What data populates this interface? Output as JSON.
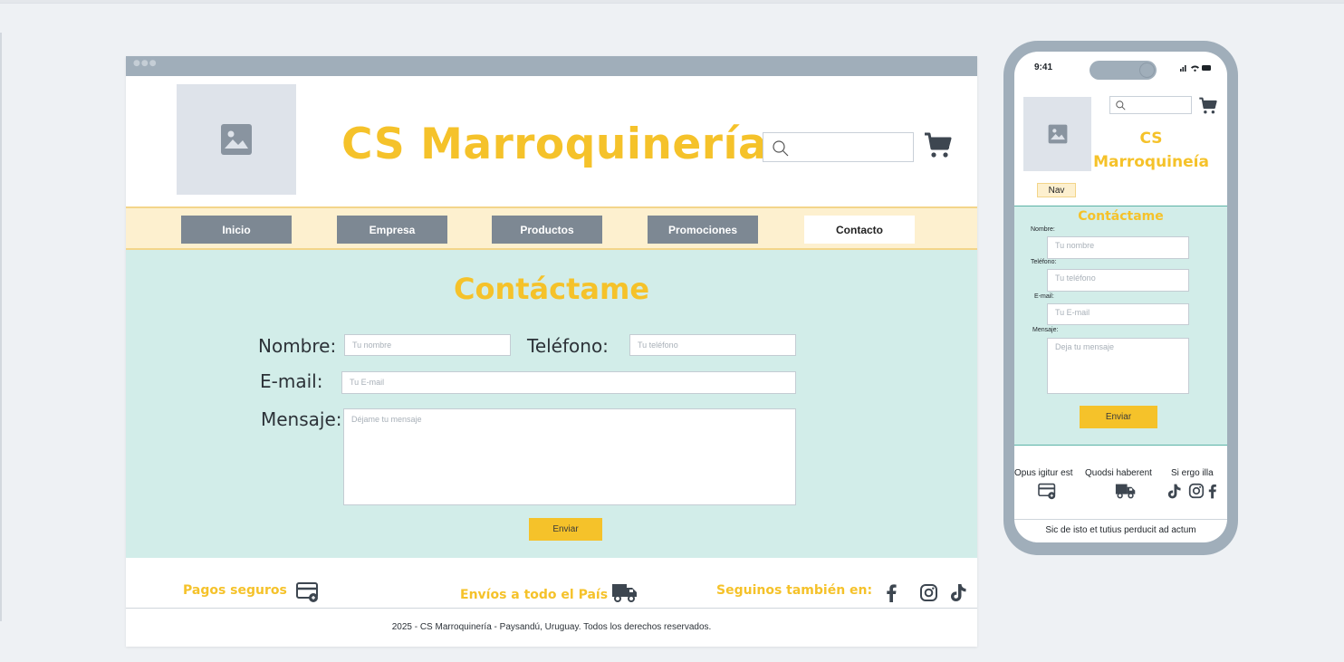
{
  "desktop": {
    "brand": "CS Marroquinería",
    "nav": [
      "Inicio",
      "Empresa",
      "Productos",
      "Promociones",
      "Contacto"
    ],
    "active_nav": "Contacto",
    "form": {
      "title": "Contáctame",
      "name_label": "Nombre:",
      "name_placeholder": "Tu nombre",
      "phone_label": "Teléfono:",
      "phone_placeholder": "Tu teléfono",
      "email_label": "E-mail:",
      "email_placeholder": "Tu E-mail",
      "message_label": "Mensaje:",
      "message_placeholder": "Déjame tu mensaje",
      "send_label": "Enviar"
    },
    "footer": {
      "payments": "Pagos seguros",
      "shipping": "Envíos a todo el País",
      "social": "Seguinos también en:",
      "copyright": "2025 - CS Marroquinería - Paysandú, Uruguay. Todos los derechos reservados."
    }
  },
  "mobile": {
    "time": "9:41",
    "brand_line1": "CS",
    "brand_line2": "Marroquineía",
    "nav": "Nav",
    "form": {
      "title": "Contáctame",
      "name_label": "Nombre:",
      "name_placeholder": "Tu nombre",
      "phone_label": "Teléfono:",
      "phone_placeholder": "Tu teléfono",
      "email_label": "E-mail:",
      "email_placeholder": "Tu E-mail",
      "message_label": "Mensaje:",
      "message_placeholder": "Deja tu mensaje",
      "send_label": "Enviar"
    },
    "footer": {
      "col1": "Opus igitur est",
      "col2": "Quodsi haberent",
      "col3": "Si ergo illa",
      "bottom": "Sic de isto et tutius perducit ad actum"
    }
  },
  "icons": [
    "image-placeholder-icon",
    "search-icon",
    "cart-icon",
    "credit-card-icon",
    "truck-icon",
    "facebook-icon",
    "instagram-icon",
    "tiktok-icon"
  ],
  "colors": {
    "accent": "#f5c22a",
    "nav_button": "#7d8893",
    "content_bg": "#d2ede9",
    "nav_bg": "#fdf0cf",
    "frame": "#a0aeba"
  }
}
